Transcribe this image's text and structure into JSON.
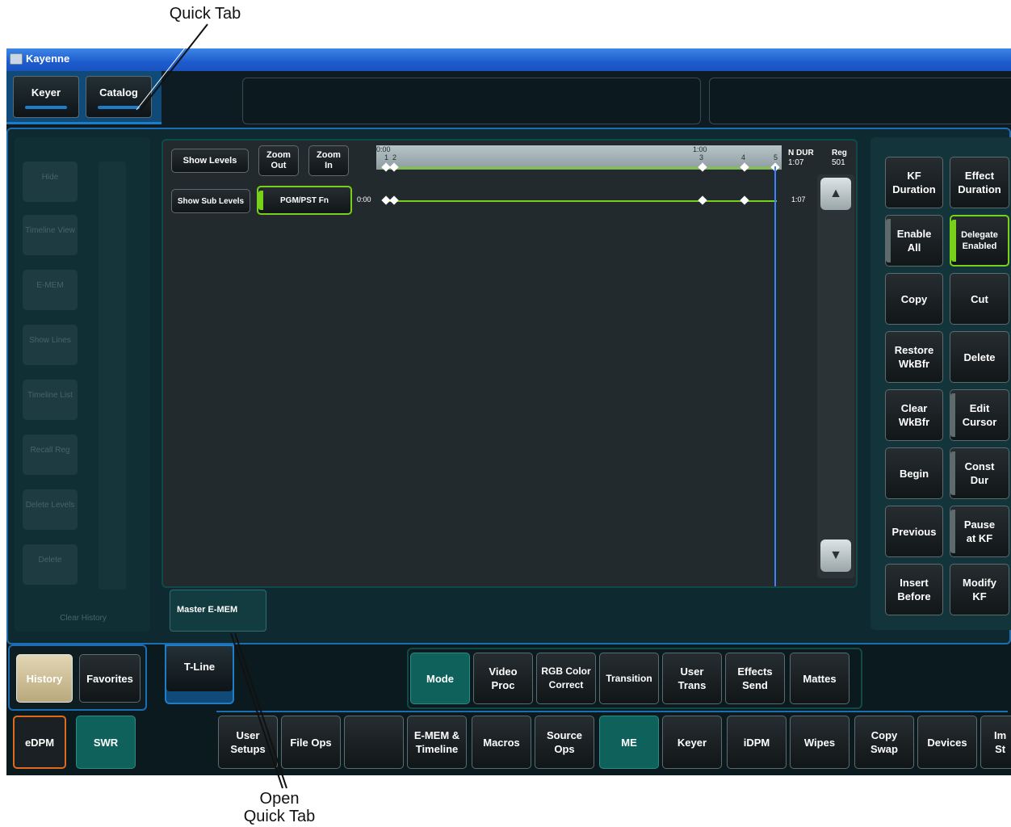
{
  "callouts": {
    "quick_tab": "Quick Tab",
    "open_quick_tab_line1": "Open",
    "open_quick_tab_line2": "Quick Tab"
  },
  "window": {
    "title": "Kayenne"
  },
  "quick_tabs": [
    "Keyer",
    "Catalog"
  ],
  "timeline": {
    "show_levels": "Show Levels",
    "zoom_out": "Zoom\nOut",
    "zoom_in": "Zoom\nIn",
    "show_sub_levels": "Show Sub Levels",
    "level_name": "PGM/PST Fn",
    "ruler_start": "0:00",
    "ruler_mid": "1:00",
    "kf_labels": [
      "1",
      "2",
      "3",
      "4",
      "5"
    ],
    "n_dur_label": "N DUR",
    "n_dur_value": "1:07",
    "reg_label": "Reg",
    "reg_value": "501",
    "track_start": "0:00",
    "track_end": "1:07",
    "tab_label": "Master E-MEM"
  },
  "left_history": [
    "Hide",
    "Timeline\nView",
    "E-MEM",
    "Show Lines",
    "Timeline\nList",
    "Recall Reg",
    "Delete\nLevels",
    "Delete"
  ],
  "left_clear": "Clear History",
  "kf_buttons": [
    "KF\nDuration",
    "Effect\nDuration",
    "Enable\nAll",
    "Delegate\nEnabled",
    "Copy",
    "Cut",
    "Restore\nWkBfr",
    "Delete",
    "Clear\nWkBfr",
    "Edit\nCursor",
    "Begin",
    "Const\nDur",
    "Previous",
    "Pause\nat KF",
    "Insert\nBefore",
    "Modify\nKF"
  ],
  "bottom": {
    "history": "History",
    "favorites": "Favorites",
    "tline": "T-Line",
    "mode_tabs": [
      "Mode",
      "Video\nProc",
      "RGB Color\nCorrect",
      "Transition",
      "User\nTrans",
      "Effects\nSend",
      "Mattes"
    ],
    "edpm": "eDPM",
    "swr": "SWR",
    "menu_tabs": [
      "User\nSetups",
      "File Ops",
      "",
      "E-MEM &\nTimeline",
      "Macros",
      "Source\nOps",
      "ME",
      "Keyer",
      "iDPM",
      "Wipes",
      "Copy\nSwap",
      "Devices",
      "Im\nSt"
    ]
  }
}
